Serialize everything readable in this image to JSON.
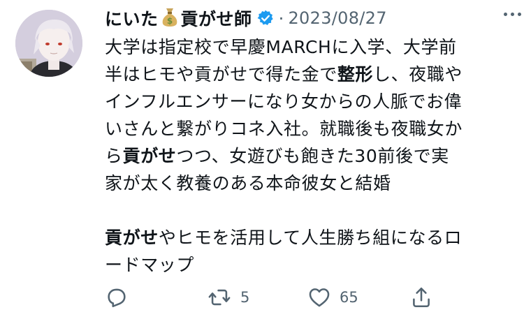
{
  "tweet": {
    "display_name": "にいた",
    "emoji": "money-bag",
    "handle_title": "貢がせ師",
    "separator": "·",
    "date": "2023/08/27",
    "body_lines": [
      [
        {
          "t": "大学は指定校で早慶MARCHに入学、大学前",
          "b": false
        }
      ],
      [
        {
          "t": "半はヒモや貢がせで得た金で",
          "b": false
        },
        {
          "t": "整形",
          "b": true
        },
        {
          "t": "し、夜職や",
          "b": false
        }
      ],
      [
        {
          "t": "インフルエンサーになり女からの人脈でお偉",
          "b": false
        }
      ],
      [
        {
          "t": "いさんと繋がりコネ入社。就職後も夜職女か",
          "b": false
        }
      ],
      [
        {
          "t": "ら",
          "b": false
        },
        {
          "t": "貢がせ",
          "b": true
        },
        {
          "t": "つつ、女遊びも飽きた30前後で実",
          "b": false
        }
      ],
      [
        {
          "t": "家が太く教養のある本命彼女と結婚",
          "b": false
        }
      ],
      [],
      [
        {
          "t": "貢がせ",
          "b": true
        },
        {
          "t": "やヒモを活用して人生勝ち組になるロ",
          "b": false
        }
      ],
      [
        {
          "t": "ードマップ",
          "b": false
        }
      ]
    ],
    "actions": {
      "reply_count": "",
      "retweet_count": "5",
      "like_count": "65",
      "share_count": ""
    }
  },
  "colors": {
    "text": "#0f1419",
    "muted": "#536471",
    "verified": "#1d9bf0"
  }
}
